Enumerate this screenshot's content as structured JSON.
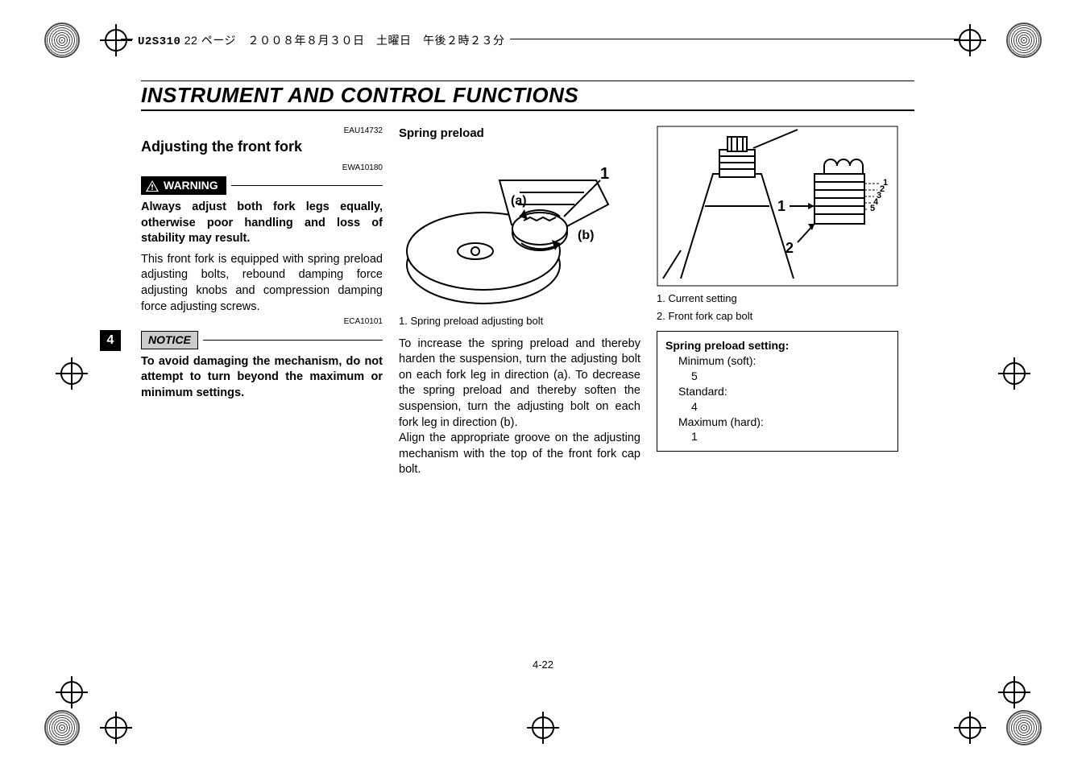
{
  "header": {
    "docid": "U2S310",
    "meta_rest": " 22 ページ　２００８年８月３０日　土曜日　午後２時２３分"
  },
  "section_title": "INSTRUMENT AND CONTROL FUNCTIONS",
  "tab_number": "4",
  "page_number": "4-22",
  "col1": {
    "code1": "EAU14732",
    "heading": "Adjusting the front fork",
    "code2": "EWA10180",
    "warning_label": "WARNING",
    "warning_text": "Always adjust both fork legs equally, otherwise poor handling and loss of stability may result.",
    "intro_text": "This front fork is equipped with spring preload adjusting bolts, rebound damping force adjusting knobs and compression damping force adjusting screws.",
    "code3": "ECA10101",
    "notice_label": "NOTICE",
    "notice_text": "To avoid damaging the mechanism, do not attempt to turn beyond the maximum or minimum settings."
  },
  "col2": {
    "heading": "Spring preload",
    "fig_labels": {
      "a": "(a)",
      "b": "(b)",
      "one": "1"
    },
    "caption1": "1. Spring preload adjusting bolt",
    "body": "To increase the spring preload and thereby harden the suspension, turn the adjusting bolt on each fork leg in direction (a). To decrease the spring preload and thereby soften the suspension, turn the adjusting bolt on each fork leg in direction (b).\nAlign the appropriate groove on the adjusting mechanism with the top of the front fork cap bolt."
  },
  "col3": {
    "fig_labels": {
      "one": "1",
      "two": "2",
      "s1": "1",
      "s2": "2",
      "s3": "3",
      "s4": "4",
      "s5": "5"
    },
    "caption1": "1. Current setting",
    "caption2": "2. Front fork cap bolt",
    "box_title": "Spring preload setting:",
    "min_label": "Minimum (soft):",
    "min_value": "5",
    "std_label": "Standard:",
    "std_value": "4",
    "max_label": "Maximum (hard):",
    "max_value": "1"
  }
}
